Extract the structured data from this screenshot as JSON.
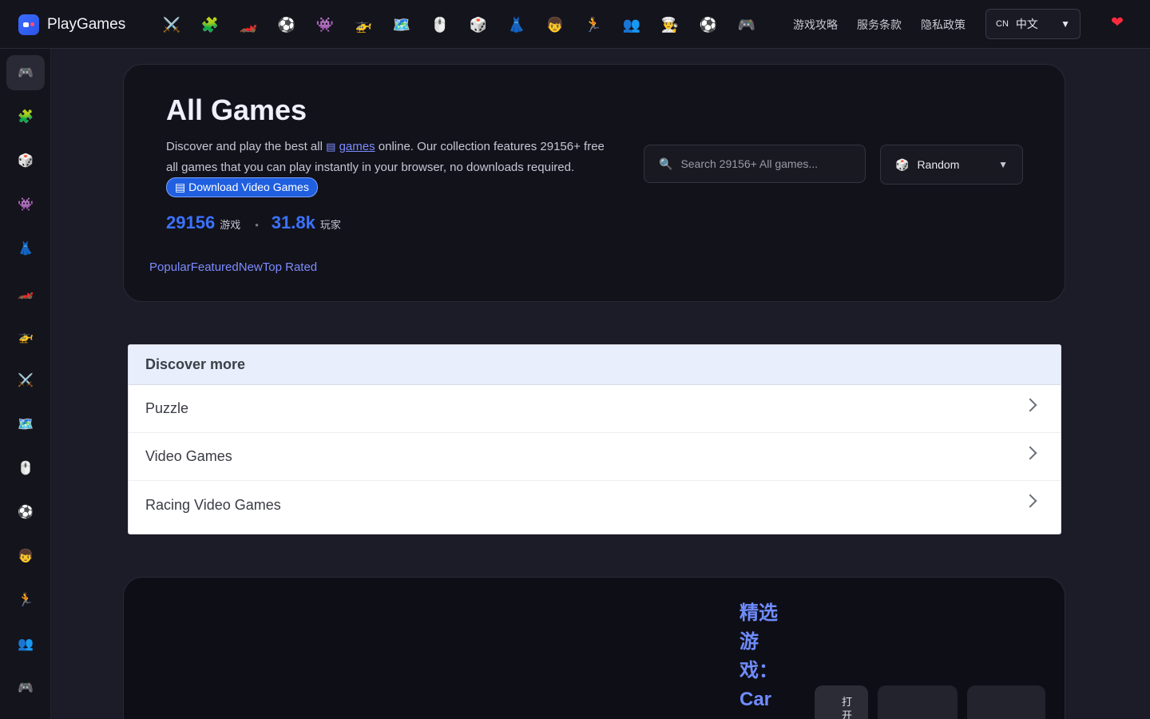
{
  "brand": {
    "name": "PlayGames"
  },
  "top_categories": [
    {
      "icon": "crossed-swords-icon",
      "glyph": "⚔️"
    },
    {
      "icon": "puzzle-piece-icon",
      "glyph": "🧩"
    },
    {
      "icon": "race-car-icon",
      "glyph": "🏎️"
    },
    {
      "icon": "soccer-ball-icon",
      "glyph": "⚽"
    },
    {
      "icon": "space-invader-icon",
      "glyph": "👾"
    },
    {
      "icon": "helicopter-icon",
      "glyph": "🚁"
    },
    {
      "icon": "map-icon",
      "glyph": "🗺️"
    },
    {
      "icon": "mouse-icon",
      "glyph": "🖱️"
    },
    {
      "icon": "dice-icon",
      "glyph": "🎲"
    },
    {
      "icon": "dress-icon",
      "glyph": "👗"
    },
    {
      "icon": "boy-face-icon",
      "glyph": "👦"
    },
    {
      "icon": "running-person-icon",
      "glyph": "🏃"
    },
    {
      "icon": "two-people-icon",
      "glyph": "👥"
    },
    {
      "icon": "chef-icon",
      "glyph": "👨‍🍳"
    },
    {
      "icon": "soccer-ball-icon",
      "glyph": "⚽"
    },
    {
      "icon": "gamepad-icon",
      "glyph": "🎮"
    }
  ],
  "top_links": [
    "游戏攻略",
    "服务条款",
    "隐私政策"
  ],
  "language": {
    "code": "CN",
    "label": "中文",
    "caret": "▼"
  },
  "favorites_icon": "❤",
  "sidebar": [
    {
      "icon": "gamepad-icon",
      "glyph": "🎮",
      "active": true
    },
    {
      "icon": "puzzle-piece-icon",
      "glyph": "🧩"
    },
    {
      "icon": "dice-icon",
      "glyph": "🎲"
    },
    {
      "icon": "space-invader-icon",
      "glyph": "👾"
    },
    {
      "icon": "dress-icon",
      "glyph": "👗"
    },
    {
      "icon": "race-car-icon",
      "glyph": "🏎️"
    },
    {
      "icon": "helicopter-icon",
      "glyph": "🚁"
    },
    {
      "icon": "crossed-swords-icon",
      "glyph": "⚔️"
    },
    {
      "icon": "map-icon",
      "glyph": "🗺️"
    },
    {
      "icon": "mouse-icon",
      "glyph": "🖱️"
    },
    {
      "icon": "soccer-ball-icon",
      "glyph": "⚽"
    },
    {
      "icon": "boy-face-icon",
      "glyph": "👦"
    },
    {
      "icon": "running-person-icon",
      "glyph": "🏃"
    },
    {
      "icon": "two-people-icon",
      "glyph": "👥"
    },
    {
      "icon": "gamepad-icon",
      "glyph": "🎮"
    }
  ],
  "hero": {
    "title": "All Games",
    "desc_prefix": "Discover and play the best all ",
    "desc_glyph": "▤",
    "desc_link": "games",
    "desc_suffix": " online. Our collection features 29156+ free all games that you can play instantly in your browser, no downloads required.",
    "download_button": "▤ Download Video Games",
    "stats": {
      "games_count": "29156",
      "games_label": "游戏",
      "separator": "•",
      "players_count": "31.8k",
      "players_label": "玩家"
    },
    "tabs": [
      "Popular",
      "Featured",
      "New",
      "Top Rated"
    ],
    "search": {
      "icon": "🔍",
      "placeholder": "Search 29156+ All games..."
    },
    "sort": {
      "icon": "🎲",
      "label": "Random",
      "caret": "▼"
    }
  },
  "discover": {
    "heading": "Discover more",
    "items": [
      "Puzzle",
      "Video Games",
      "Racing Video Games"
    ]
  },
  "featured": {
    "title": "精选游戏：Car",
    "open_label": "打开"
  },
  "colors": {
    "accent": "#3b72ff",
    "link": "#7c8cff",
    "background": "#1c1c28",
    "card": "#12121a",
    "favorite": "#ff2a3d"
  }
}
